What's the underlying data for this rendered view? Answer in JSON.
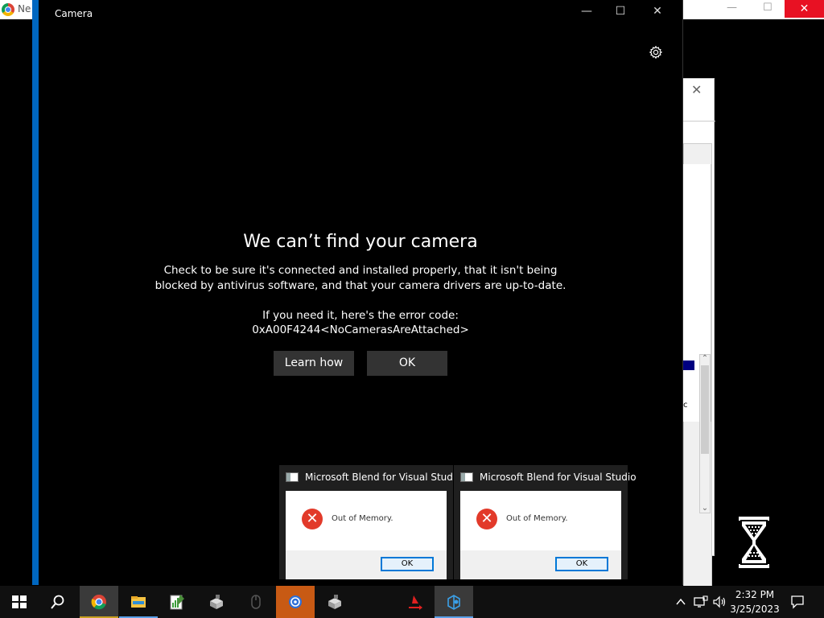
{
  "background_browser": {
    "tab_text": "Ne",
    "minimize": "—",
    "maximize": "☐",
    "close": "✕"
  },
  "background_dialog": {
    "close": "✕",
    "partial_text": "c"
  },
  "camera_window": {
    "title": "Camera",
    "minimize": "—",
    "maximize": "☐",
    "close": "✕",
    "heading": "We can’t find your camera",
    "body": "Check to be sure it's connected and installed properly, that it isn't being blocked by antivirus software, and that your camera drivers are up-to-date.",
    "error_intro": "If you need it, here's the error code:",
    "error_code": "0xA00F4244<NoCamerasAreAttached>",
    "learn_how_label": "Learn how",
    "ok_label": "OK",
    "accent_color": "#0067c0"
  },
  "error_dialogs": [
    {
      "title": "Microsoft Blend for Visual Studio",
      "message": "Out of Memory.",
      "ok_label": "OK"
    },
    {
      "title": "Microsoft Blend for Visual Studio",
      "message": "Out of Memory.",
      "ok_label": "OK"
    }
  ],
  "taskbar": {
    "items": [
      {
        "name": "start-icon"
      },
      {
        "name": "search-icon"
      },
      {
        "name": "chrome-icon",
        "state": "active"
      },
      {
        "name": "file-explorer-icon",
        "state": "running"
      },
      {
        "name": "notepad-chart-icon"
      },
      {
        "name": "setup-box-icon"
      },
      {
        "name": "mouse-icon"
      },
      {
        "name": "app-settings-icon",
        "state": "orange"
      },
      {
        "name": "setup-box-icon"
      },
      {
        "name": "flag-arrow-icon"
      },
      {
        "name": "blend-icon",
        "state": "active"
      }
    ],
    "time": "2:32 PM",
    "date": "3/25/2023",
    "tray": [
      "chevron-up-icon",
      "network-icon",
      "volume-icon",
      "notification-icon"
    ]
  }
}
